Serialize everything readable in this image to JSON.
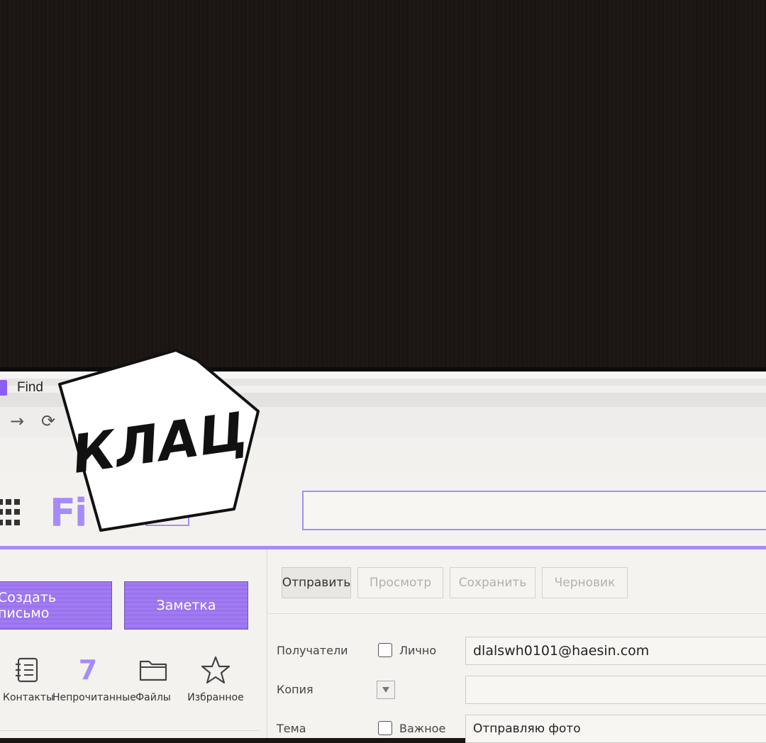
{
  "colors": {
    "accent": "#a78bfa",
    "button_bg": "#9a72ee"
  },
  "browser": {
    "tab_title": "Find"
  },
  "app": {
    "logo_text": "Fi"
  },
  "sidebar": {
    "create_button": "Создать письмо",
    "note_button": "Заметка",
    "quick": [
      {
        "label": "Контакты",
        "icon": "contacts-icon"
      },
      {
        "label": "Непрочитанные",
        "count": "7"
      },
      {
        "label": "Файлы",
        "icon": "folder-icon"
      },
      {
        "label": "Избранное",
        "icon": "star-icon"
      }
    ]
  },
  "toolbar": {
    "send": "Отправить",
    "preview": "Просмотр",
    "save": "Сохранить",
    "draft": "Черновик"
  },
  "compose": {
    "recipients_label": "Получатели",
    "personal_label": "Лично",
    "recipients_value": "dlalswh0101@haesin.com",
    "cc_label": "Копия",
    "cc_value": "",
    "subject_label": "Тема",
    "important_label": "Важное",
    "subject_value": "Отправляю фото"
  },
  "sfx": {
    "text": "КЛАЦ"
  }
}
